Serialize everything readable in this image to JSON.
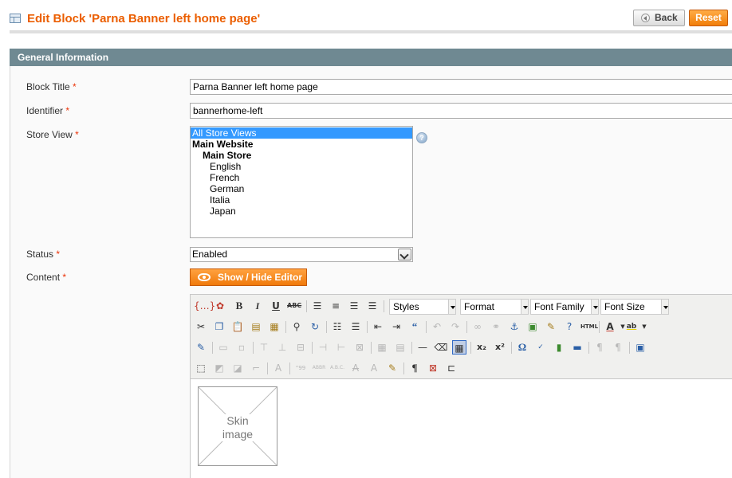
{
  "header": {
    "title": "Edit Block 'Parna Banner left home page'",
    "back_label": "Back",
    "reset_label": "Reset"
  },
  "section": {
    "title": "General Information"
  },
  "form": {
    "block_title": {
      "label": "Block Title",
      "required": "*",
      "value": "Parna Banner left home page"
    },
    "identifier": {
      "label": "Identifier",
      "required": "*",
      "value": "bannerhome-left"
    },
    "store_view": {
      "label": "Store View",
      "required": "*",
      "options": {
        "all": "All Store Views",
        "website": "Main Website",
        "store": "Main Store",
        "english": "English",
        "french": "French",
        "german": "German",
        "italia": "Italia",
        "japan": "Japan"
      },
      "selected": "All Store Views"
    },
    "status": {
      "label": "Status",
      "required": "*",
      "value": "Enabled"
    },
    "content": {
      "label": "Content",
      "required": "*",
      "toggle_label": "Show / Hide Editor"
    }
  },
  "editor": {
    "styles_placeholder": "Styles",
    "format_placeholder": "Format",
    "font_family_placeholder": "Font Family",
    "font_size_placeholder": "Font Size",
    "image_placeholder": "Skin\nimage",
    "image_line1": "Skin",
    "image_line2": "image"
  },
  "colors": {
    "accent": "#eb5e00",
    "section_bar": "#6f8992",
    "selection": "#3399ff"
  }
}
